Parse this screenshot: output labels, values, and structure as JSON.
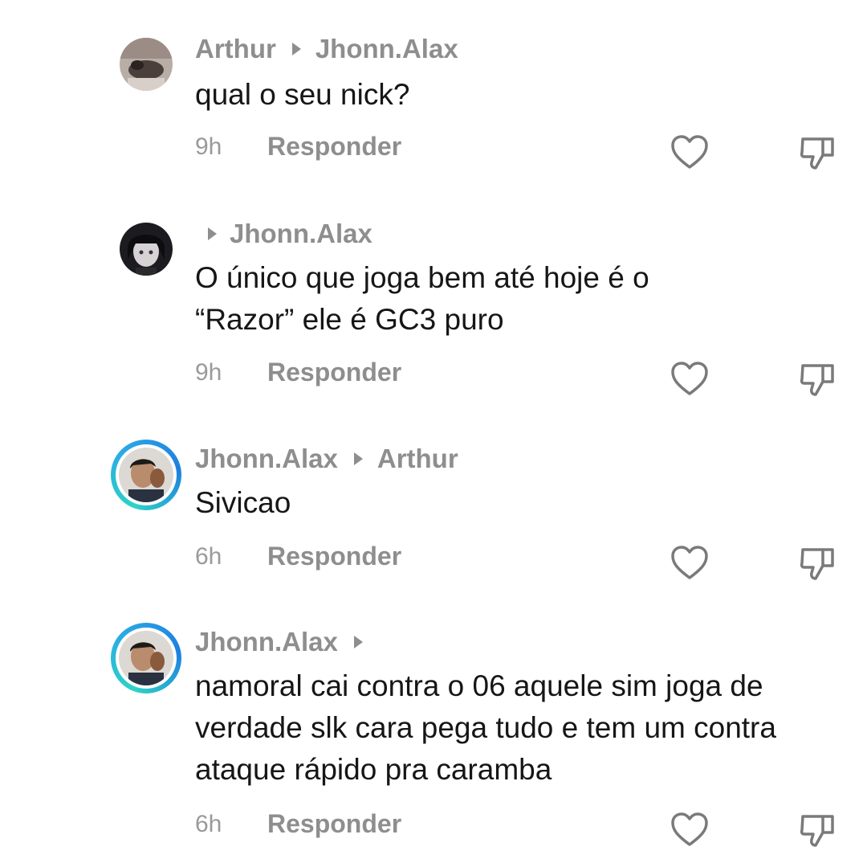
{
  "comments": [
    {
      "author": "Arthur",
      "reply_to": "Jhonn.Alax",
      "text": "qual o seu nick?",
      "time": "9h",
      "reply_label": "Responder"
    },
    {
      "author": "",
      "reply_to": "Jhonn.Alax",
      "text": "O único que joga bem até hoje é o “Razor” ele é GC3 puro",
      "time": "9h",
      "reply_label": "Responder"
    },
    {
      "author": "Jhonn.Alax",
      "reply_to": "Arthur",
      "text": "Sivicao",
      "time": "6h",
      "reply_label": "Responder"
    },
    {
      "author": "Jhonn.Alax",
      "reply_to": "",
      "text": "namoral cai contra o 06 aquele sim joga de verdade slk cara pega tudo e tem um contra ataque rápido pra caramba",
      "time": "6h",
      "reply_label": "Responder"
    }
  ],
  "icons": {
    "like": "heart-outline-icon",
    "dislike": "thumbs-down-outline-icon"
  },
  "colors": {
    "ring_start": "#2ed3c6",
    "ring_end": "#1f7fe0",
    "muted": "#8e8e8e"
  }
}
